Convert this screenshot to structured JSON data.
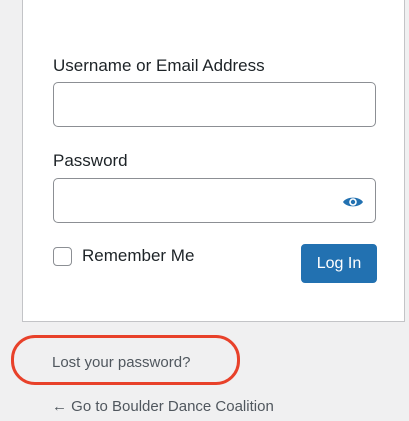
{
  "form": {
    "username_label": "Username or Email Address",
    "username_value": "",
    "password_label": "Password",
    "password_value": "",
    "show_password_icon": "eye-icon",
    "remember_label": "Remember Me",
    "remember_checked": false,
    "login_button_label": "Log In"
  },
  "links": {
    "lost_password": "Lost your password?",
    "back_to_site": "← Go to Boulder Dance Coalition"
  },
  "colors": {
    "accent": "#2271b1",
    "highlight_ring": "#e8412a",
    "page_background": "#f0f0f1"
  }
}
